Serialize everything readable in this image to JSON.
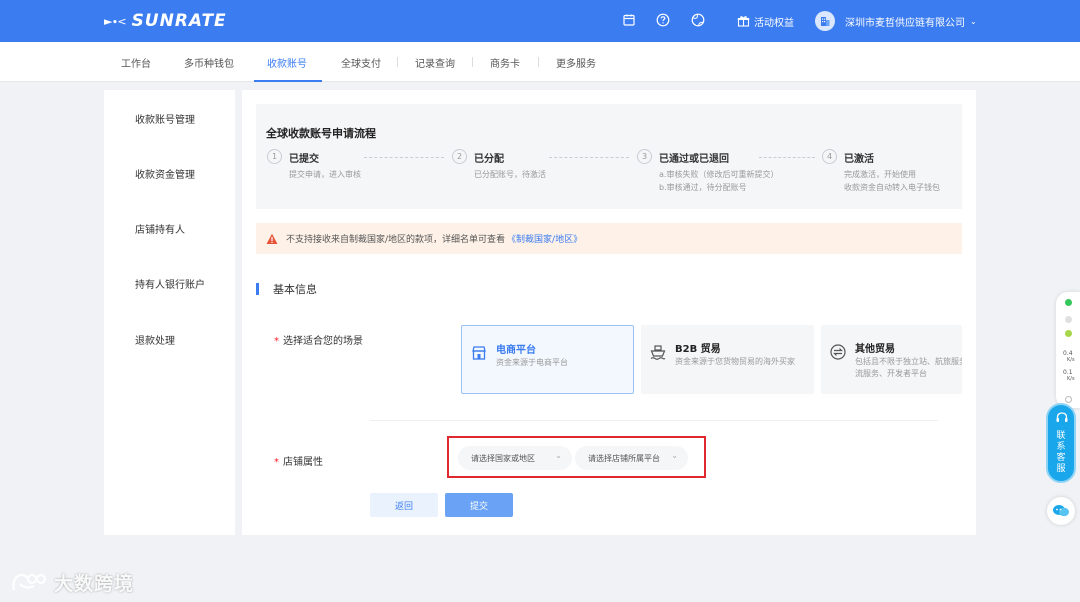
{
  "brand": {
    "name": "SUNRATE",
    "mark": "►∙<"
  },
  "header": {
    "promo_label": "活动权益",
    "company_name": "深圳市麦哲供应链有限公司",
    "icons": [
      "calendar-icon",
      "help-icon",
      "globe-icon",
      "gift-icon",
      "building-icon"
    ]
  },
  "nav": {
    "items": [
      {
        "label": "工作台"
      },
      {
        "label": "多币种钱包"
      },
      {
        "label": "收款账号"
      },
      {
        "label": "全球支付"
      },
      {
        "label": "记录查询"
      },
      {
        "label": "商务卡"
      },
      {
        "label": "更多服务"
      }
    ],
    "active_index": 2
  },
  "sidebar": {
    "items": [
      {
        "label": "收款账号管理"
      },
      {
        "label": "收款资金管理"
      },
      {
        "label": "店铺持有人"
      },
      {
        "label": "持有人银行账户"
      },
      {
        "label": "退款处理"
      }
    ]
  },
  "flow": {
    "title": "全球收款账号申请流程",
    "steps": [
      {
        "num": "1",
        "title": "已提交",
        "desc": [
          "提交申请，进入审核"
        ]
      },
      {
        "num": "2",
        "title": "已分配",
        "desc": [
          "已分配账号，待激活"
        ]
      },
      {
        "num": "3",
        "title": "已通过或已退回",
        "desc": [
          "a.审核失败（修改后可重新提交）",
          "b.审核通过，待分配账号"
        ]
      },
      {
        "num": "4",
        "title": "已激活",
        "desc": [
          "完成激活，开始使用",
          "收款资金自动转入电子钱包"
        ]
      }
    ]
  },
  "notice": {
    "text": "不支持接收来自制裁国家/地区的款项，详细名单可查看",
    "link": "《制裁国家/地区》"
  },
  "section": {
    "title": "基本信息"
  },
  "form": {
    "scenario_label": "选择适合您的场景",
    "scenarios": [
      {
        "title": "电商平台",
        "desc": "资金来源于电商平台",
        "selected": true,
        "icon": "storefront-icon"
      },
      {
        "title": "B2B 贸易",
        "desc": "资金来源于您货物贸易的海外买家",
        "selected": false,
        "icon": "ship-icon"
      },
      {
        "title": "其他贸易",
        "desc": "包括且不限于独立站、航旅服务、物流服务、开发者平台",
        "selected": false,
        "icon": "exchange-icon"
      }
    ],
    "store_label": "店铺属性",
    "country_placeholder": "请选择国家或地区",
    "platform_placeholder": "请选择店铺所属平台",
    "required_mark": "*"
  },
  "buttons": {
    "back": "返回",
    "submit": "提交"
  },
  "floating": {
    "metrics": [
      "0.4",
      "0.1"
    ],
    "metric_units": [
      "K/s",
      "K/s"
    ],
    "customer_service": [
      "联",
      "系",
      "客",
      "服"
    ]
  },
  "watermark": {
    "text": "大数跨境"
  },
  "colors": {
    "primary": "#3b7cf0",
    "warning_bg": "#fdf1e8",
    "required": "#f5222d",
    "highlight": "#e0282f"
  }
}
